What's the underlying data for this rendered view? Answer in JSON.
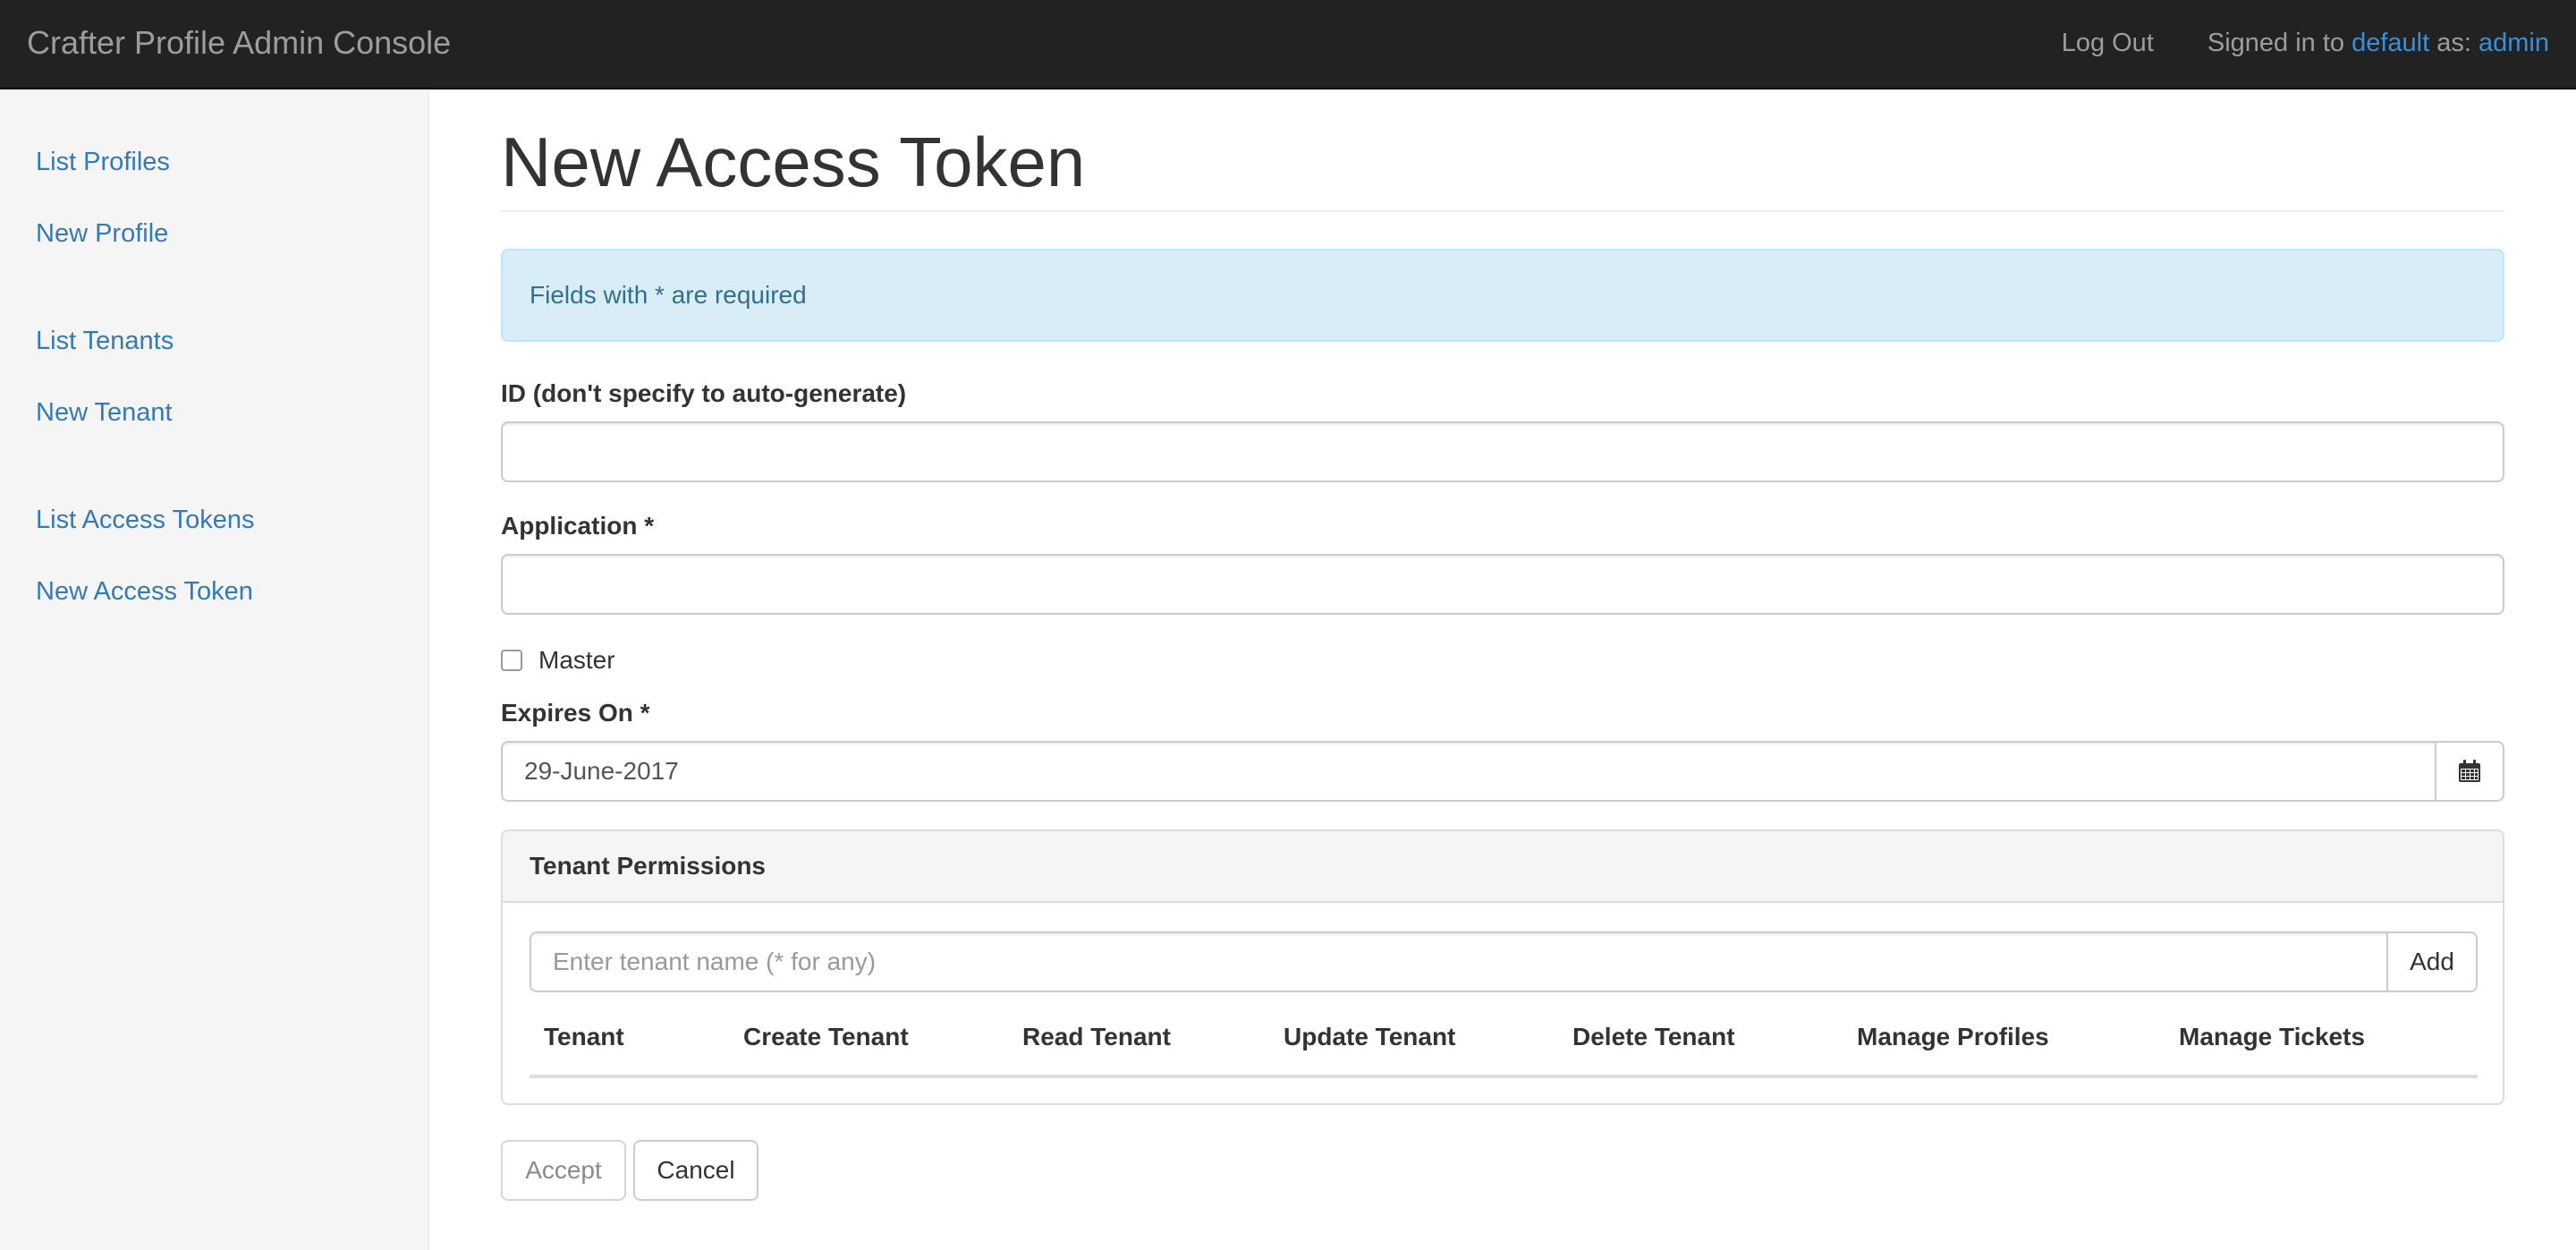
{
  "navbar": {
    "brand": "Crafter Profile Admin Console",
    "logout": "Log Out",
    "signed_in_prefix": "Signed in to ",
    "tenant": "default",
    "signed_in_mid": " as: ",
    "user": "admin"
  },
  "sidebar": {
    "items": [
      {
        "label": "List Profiles"
      },
      {
        "label": "New Profile"
      },
      {
        "label": "List Tenants"
      },
      {
        "label": "New Tenant"
      },
      {
        "label": "List Access Tokens"
      },
      {
        "label": "New Access Token"
      }
    ]
  },
  "page": {
    "title": "New Access Token",
    "alert": "Fields with * are required"
  },
  "form": {
    "id_label": "ID (don't specify to auto-generate)",
    "id_value": "",
    "application_label": "Application *",
    "application_value": "",
    "master_label": "Master",
    "master_checked": false,
    "expires_label": "Expires On *",
    "expires_value": "29-June-2017",
    "calendar_icon": "calendar-icon"
  },
  "permissions": {
    "heading": "Tenant Permissions",
    "tenant_placeholder": "Enter tenant name (* for any)",
    "add_label": "Add",
    "columns": [
      "Tenant",
      "Create Tenant",
      "Read Tenant",
      "Update Tenant",
      "Delete Tenant",
      "Manage Profiles",
      "Manage Tickets"
    ],
    "rows": []
  },
  "actions": {
    "accept": "Accept",
    "cancel": "Cancel"
  },
  "colors": {
    "navbar_bg": "#222222",
    "link": "#337ab7",
    "alert_bg": "#d9edf7",
    "alert_text": "#31708f"
  }
}
